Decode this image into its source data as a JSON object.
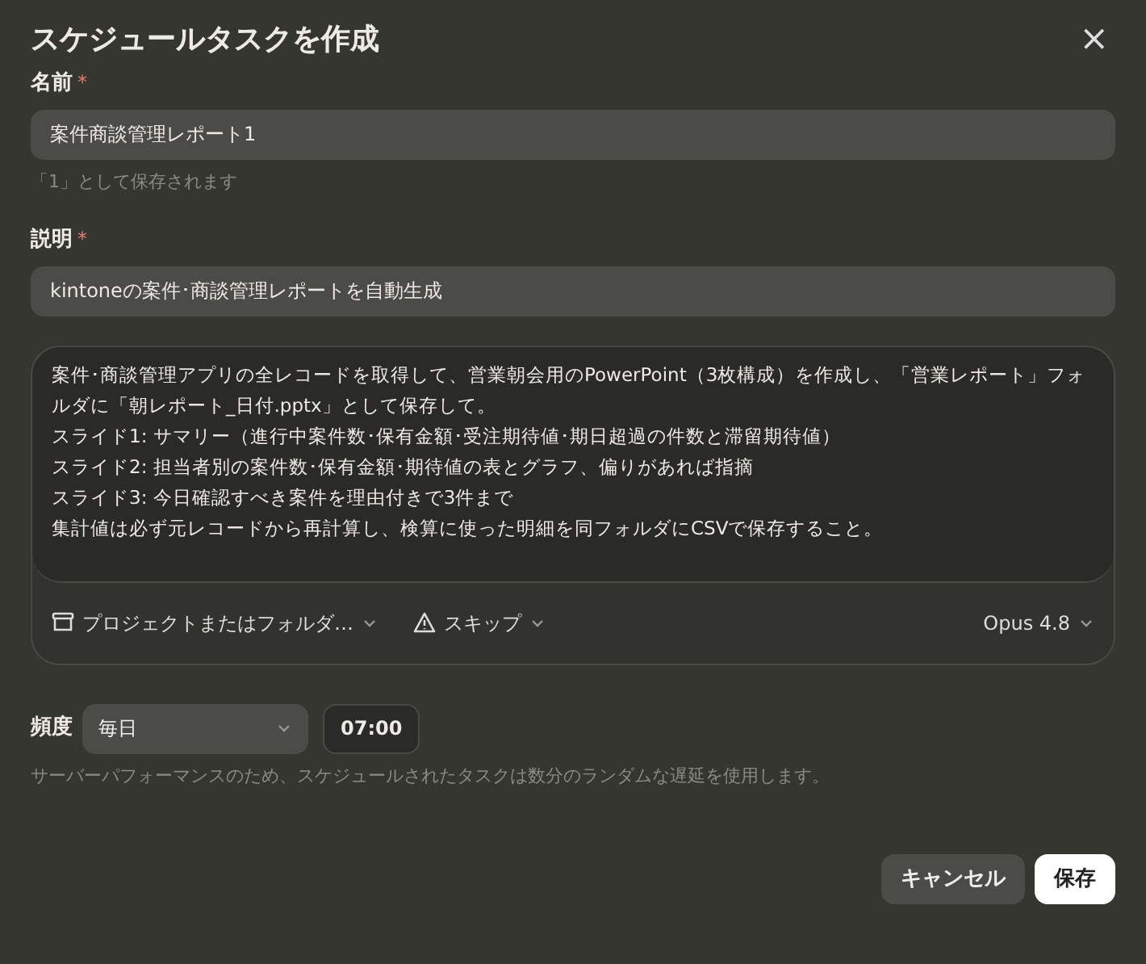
{
  "dialog": {
    "title": "スケジュールタスクを作成",
    "close": "×"
  },
  "name_field": {
    "label": "名前",
    "required_mark": "*",
    "value": "案件商談管理レポート1",
    "hint": "「1」として保存されます"
  },
  "description_field": {
    "label": "説明",
    "required_mark": "*",
    "value": "kintoneの案件･商談管理レポートを自動生成"
  },
  "prompt": {
    "lines": [
      "案件･商談管理アプリの全レコードを取得して、営業朝会用のPowerPoint（3枚構成）を作成し、「営業レポート」フォルダに「朝レポート_日付.pptx」として保存して。",
      "スライド1: サマリー（進行中案件数･保有金額･受注期待値･期日超過の件数と滞留期待値）",
      "スライド2: 担当者別の案件数･保有金額･期待値の表とグラフ、偏りがあれば指摘",
      "スライド3: 今日確認すべき案件を理由付きで3件まで",
      "集計値は必ず元レコードから再計算し、検算に使った明細を同フォルダにCSVで保存すること。"
    ],
    "toolbar": [
      {
        "kind": "folder",
        "label": "プロジェクトまたはフォルダ…"
      },
      {
        "kind": "permission",
        "label": "スキップ"
      },
      {
        "kind": "model",
        "label": "Opus 4.8"
      }
    ]
  },
  "frequency": {
    "label": "頻度",
    "value": "毎日",
    "time": "07:00",
    "note": "サーバーパフォーマンスのため、スケジュールされたタスクは数分のランダムな遅延を使用します。"
  },
  "buttons": [
    {
      "kind": "secondary",
      "label": "キャンセル"
    },
    {
      "kind": "primary",
      "label": "保存"
    }
  ]
}
